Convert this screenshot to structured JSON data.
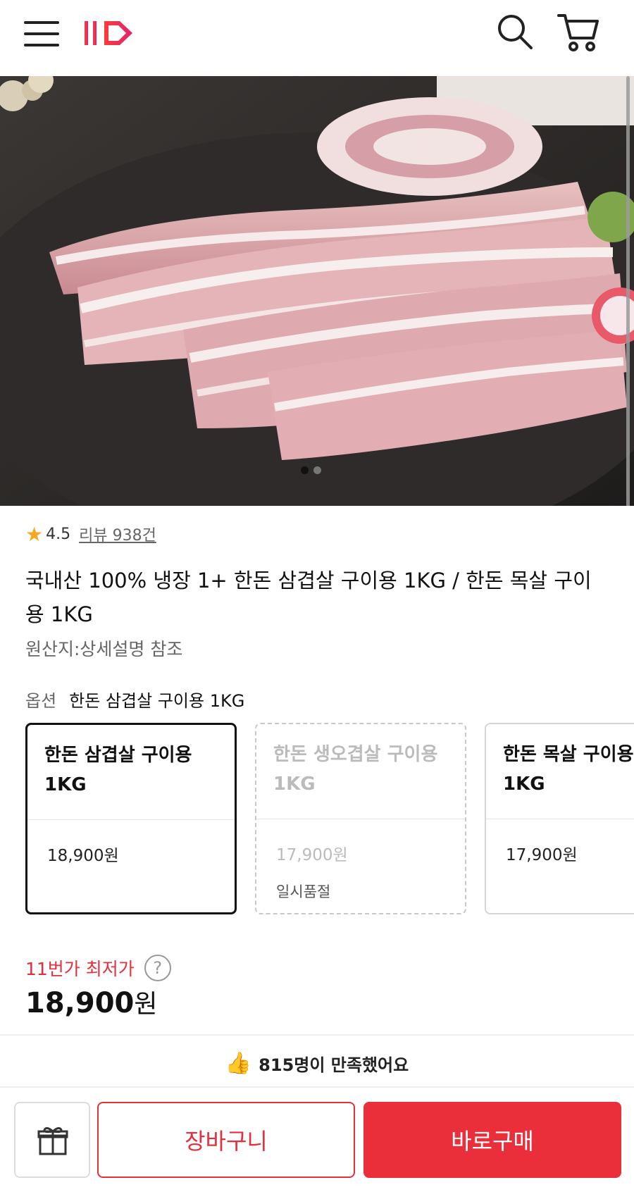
{
  "header": {
    "logo_text": "11",
    "brand_color": "#e3303c",
    "icons": [
      "menu-icon",
      "search-icon",
      "cart-icon"
    ]
  },
  "hero": {
    "image_desc": "raw pork belly slices on dark slate",
    "carousel_active_index": 1,
    "carousel_total": 2
  },
  "rating": {
    "score": "4.5",
    "review_label": "리뷰 938건"
  },
  "product": {
    "title": "국내산 100% 냉장 1+ 한돈 삼겹살 구이용 1KG / 한돈 목살 구이용 1KG",
    "origin": "원산지:상세설명 참조"
  },
  "option": {
    "label": "옵션",
    "selected_value": "한돈 삼겹살 구이용 1KG",
    "cards": [
      {
        "name": "한돈 삼겹살 구이용 1KG",
        "price": "18,900원",
        "note": "",
        "state": "selected"
      },
      {
        "name": "한돈 생오겹살 구이용 1KG",
        "price": "17,900원",
        "note": "일시품절",
        "state": "soldout"
      },
      {
        "name": "한돈 목살 구이용 1KG",
        "price": "17,900원",
        "note": "",
        "state": "normal"
      }
    ]
  },
  "pricing": {
    "lowest_label": "11번가 최저가",
    "help_symbol": "?",
    "price_number": "18,900",
    "price_unit": "원"
  },
  "satisfaction": {
    "text": "815명이 만족했어요"
  },
  "actions": {
    "gift_icon": "gift-icon",
    "cart_label": "장바구니",
    "buy_label": "바로구매"
  }
}
